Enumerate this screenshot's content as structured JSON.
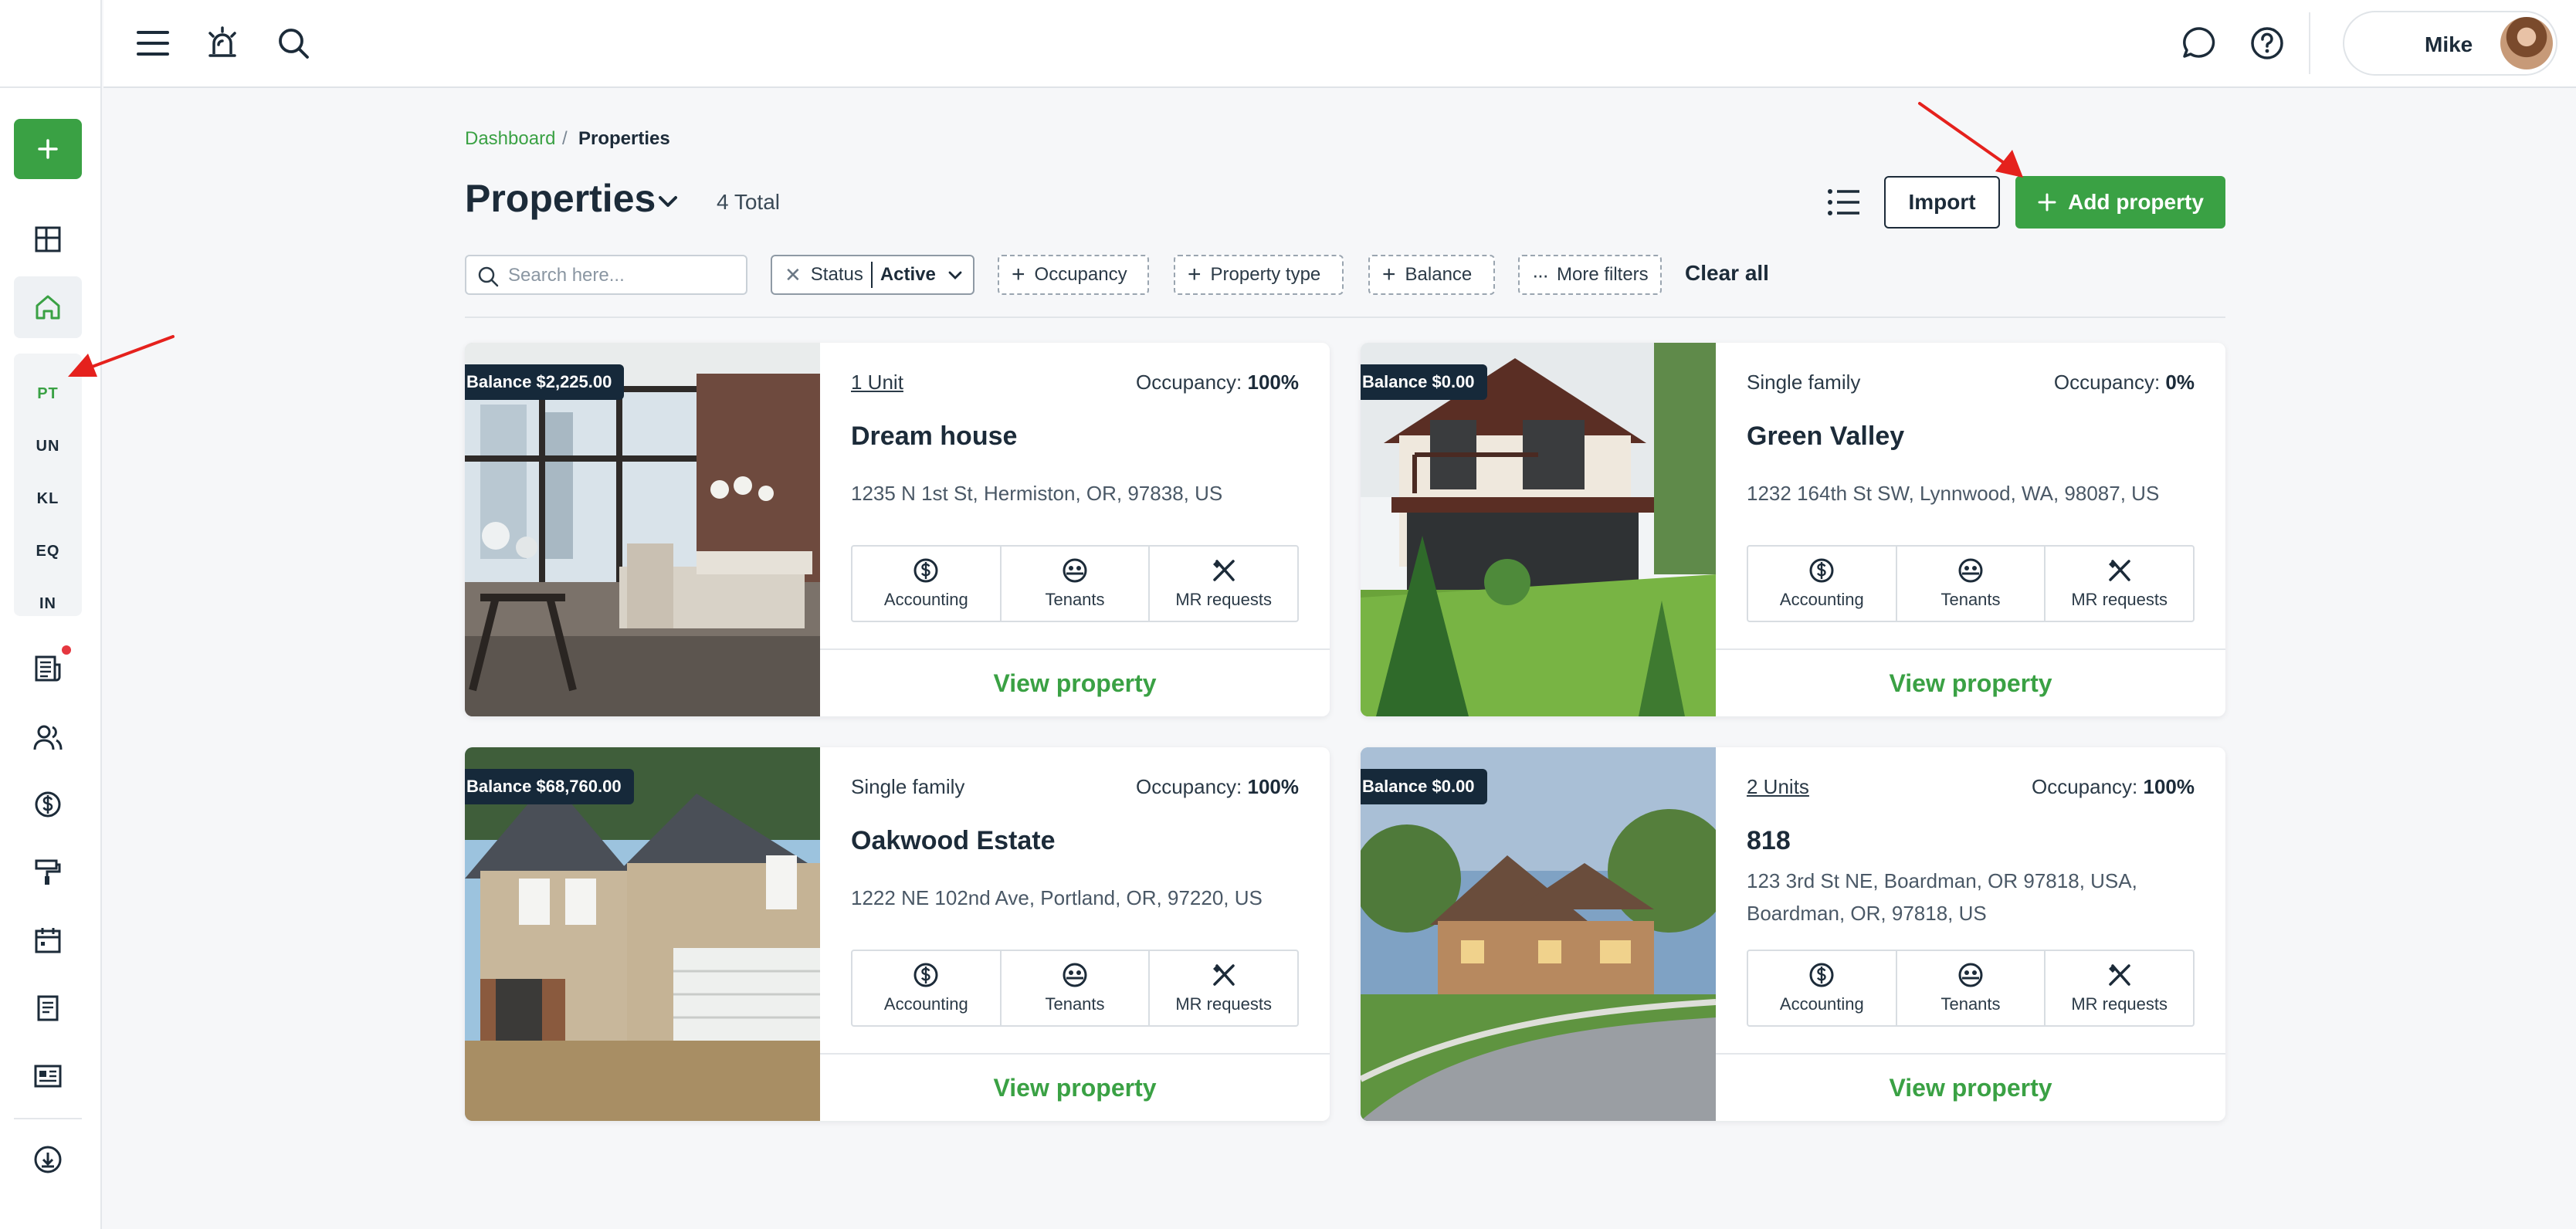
{
  "topbar": {
    "user_name": "Mike"
  },
  "sidebar": {
    "properties_subnav": [
      {
        "label": "PT",
        "active": true
      },
      {
        "label": "UN",
        "active": false
      },
      {
        "label": "KL",
        "active": false
      },
      {
        "label": "EQ",
        "active": false
      },
      {
        "label": "IN",
        "active": false
      }
    ]
  },
  "breadcrumb": {
    "parent": "Dashboard",
    "separator": "/",
    "current": "Properties"
  },
  "header": {
    "title": "Properties",
    "total": "4 Total",
    "import_label": "Import",
    "add_label": "Add property"
  },
  "filters": {
    "search_placeholder": "Search here...",
    "status_label": "Status",
    "status_value": "Active",
    "occupancy": "Occupancy",
    "property_type": "Property type",
    "balance": "Balance",
    "more_filters": "More filters",
    "clear_all": "Clear all"
  },
  "actions": {
    "accounting": "Accounting",
    "tenants": "Tenants",
    "mr_requests": "MR requests",
    "view": "View property"
  },
  "occupancy_label": "Occupancy:",
  "properties": [
    {
      "balance": "Balance $2,225.00",
      "type": "1 Unit",
      "occupancy": "100%",
      "name": "Dream house",
      "address": "1235 N 1st St, Hermiston, OR, 97838, US"
    },
    {
      "balance": "Balance $0.00",
      "type": "Single family",
      "occupancy": "0%",
      "name": "Green Valley",
      "address": "1232 164th St SW, Lynnwood, WA, 98087, US"
    },
    {
      "balance": "Balance $68,760.00",
      "type": "Single family",
      "occupancy": "100%",
      "name": "Oakwood Estate",
      "address": "1222 NE 102nd Ave, Portland, OR, 97220, US"
    },
    {
      "balance": "Balance $0.00",
      "type": "2 Units",
      "occupancy": "100%",
      "name": "818",
      "address": "123 3rd St NE, Boardman, OR 97818, USA, Boardman, OR, 97818, US"
    }
  ],
  "colors": {
    "brand_green": "#3aa144",
    "navy": "#16293a",
    "annotation_red": "#e5211d"
  }
}
